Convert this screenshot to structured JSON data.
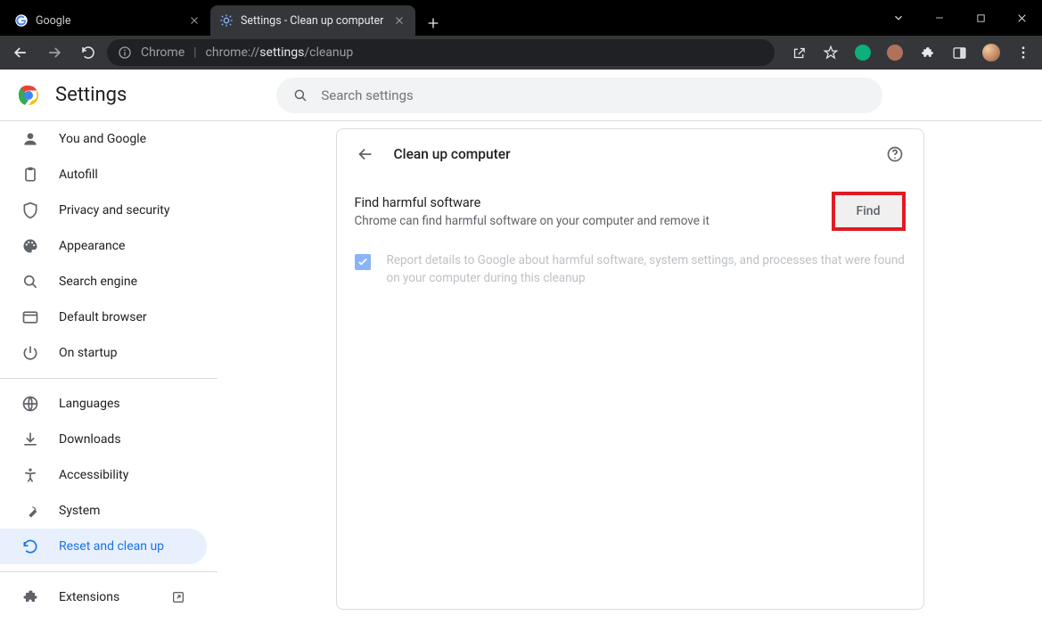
{
  "window": {
    "tabs": [
      {
        "label": "Google",
        "active": false
      },
      {
        "label": "Settings - Clean up computer",
        "active": true
      }
    ]
  },
  "toolbar": {
    "omni_site": "Chrome",
    "omni_url_prefix": "chrome://",
    "omni_url_bold": "settings",
    "omni_url_suffix": "/cleanup"
  },
  "header": {
    "title": "Settings",
    "search_placeholder": "Search settings"
  },
  "sidebar": {
    "items1": [
      {
        "label": "You and Google"
      },
      {
        "label": "Autofill"
      },
      {
        "label": "Privacy and security"
      },
      {
        "label": "Appearance"
      },
      {
        "label": "Search engine"
      },
      {
        "label": "Default browser"
      },
      {
        "label": "On startup"
      }
    ],
    "items2": [
      {
        "label": "Languages"
      },
      {
        "label": "Downloads"
      },
      {
        "label": "Accessibility"
      },
      {
        "label": "System"
      },
      {
        "label": "Reset and clean up"
      }
    ],
    "items3": [
      {
        "label": "Extensions"
      }
    ]
  },
  "content": {
    "page_title": "Clean up computer",
    "find_title": "Find harmful software",
    "find_desc": "Chrome can find harmful software on your computer and remove it",
    "find_button": "Find",
    "report_desc": "Report details to Google about harmful software, system settings, and processes that were found on your computer during this cleanup"
  }
}
